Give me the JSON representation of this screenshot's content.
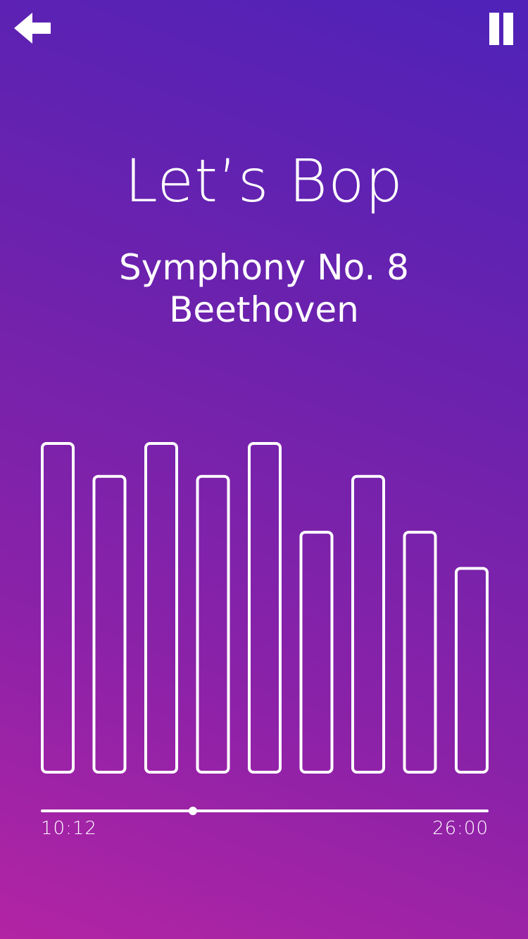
{
  "header": {
    "back_icon": "arrow-left-icon",
    "pause_icon": "pause-icon"
  },
  "player": {
    "playlist_title": "Let’s Bop",
    "track_name": "Symphony No. 8",
    "composer": "Beethoven",
    "elapsed": "10:12",
    "duration": "26:00",
    "progress_fraction": 0.34
  },
  "visualizer": {
    "levels": [
      1.0,
      0.9,
      1.0,
      0.9,
      1.0,
      0.73,
      0.9,
      0.73,
      0.62
    ]
  },
  "colors": {
    "gradient_top": "#4f22b8",
    "gradient_bottom": "#b224a4",
    "foreground": "#ffffff"
  }
}
